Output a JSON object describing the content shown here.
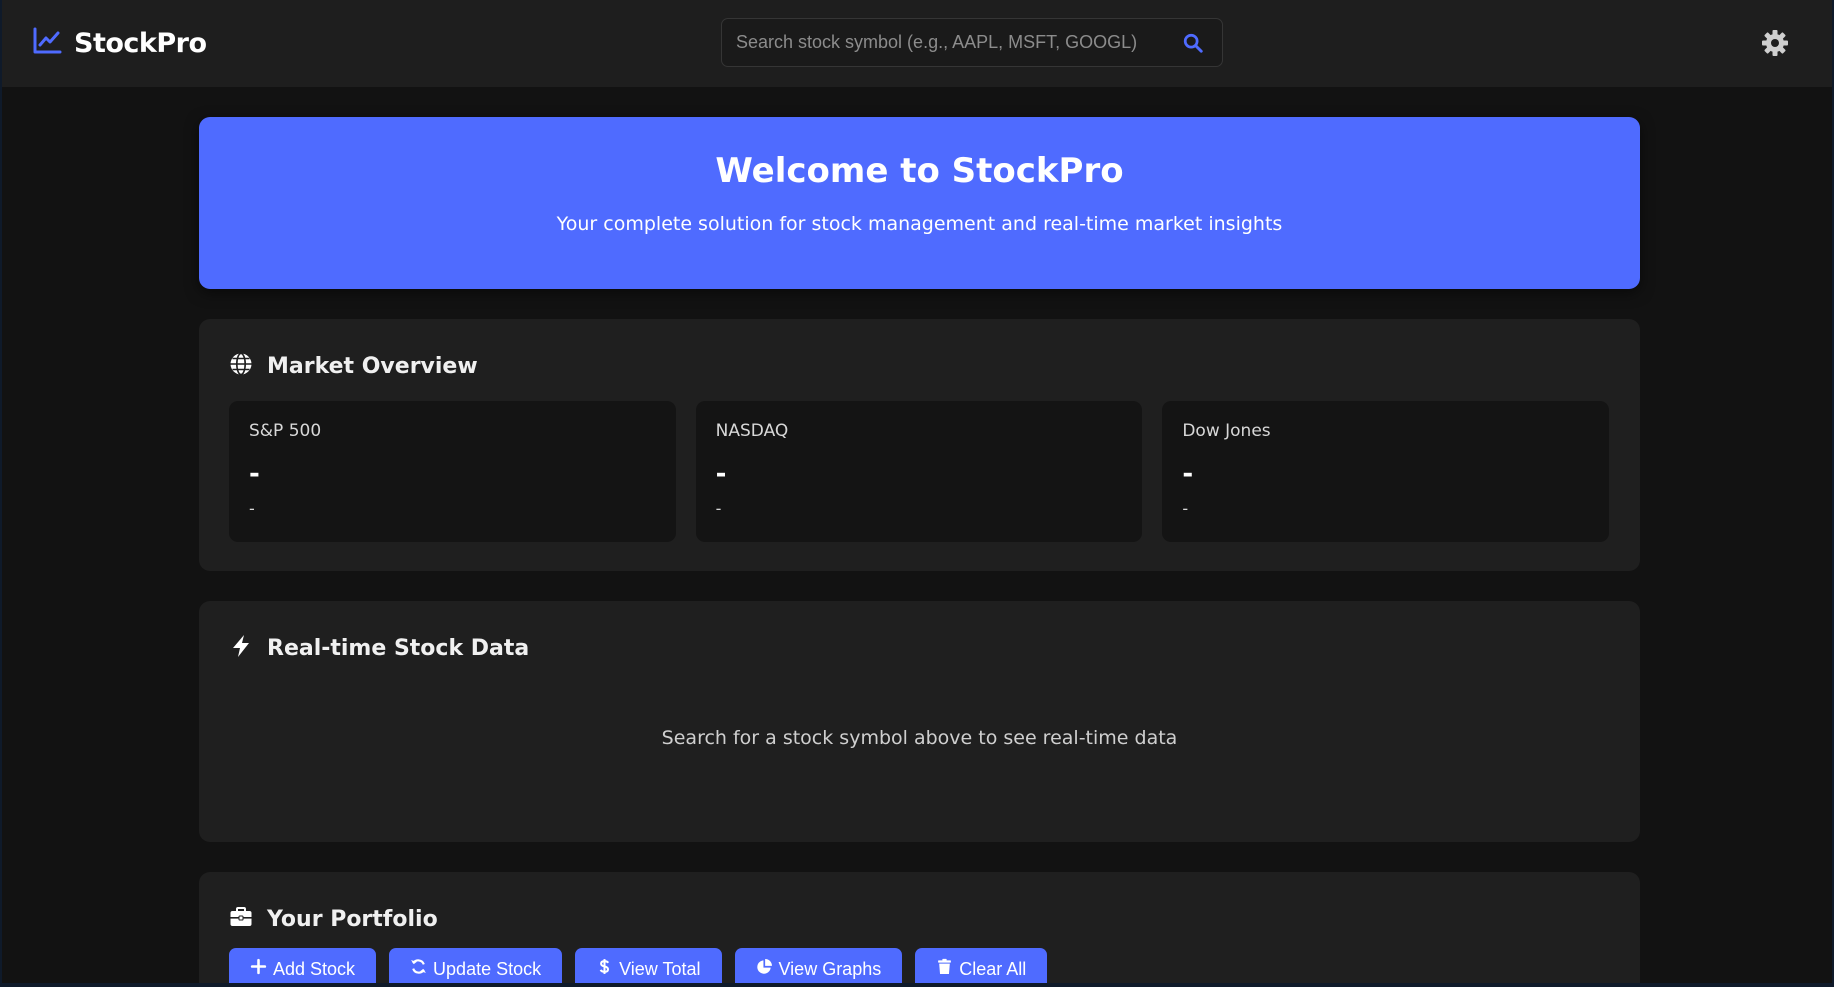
{
  "app": {
    "name": "StockPro",
    "accent_color": "#4f6bff"
  },
  "header": {
    "logo_icon": "chart-line-icon",
    "search": {
      "placeholder": "Search stock symbol (e.g., AAPL, MSFT, GOOGL)",
      "value": "",
      "icon": "search-icon"
    },
    "settings_icon": "gear-icon"
  },
  "hero": {
    "title": "Welcome to StockPro",
    "subtitle": "Your complete solution for stock management and real-time market insights"
  },
  "market_overview": {
    "title": "Market Overview",
    "icon": "globe-icon",
    "indices": [
      {
        "name": "S&P 500",
        "value": "-",
        "change": "-"
      },
      {
        "name": "NASDAQ",
        "value": "-",
        "change": "-"
      },
      {
        "name": "Dow Jones",
        "value": "-",
        "change": "-"
      }
    ]
  },
  "realtime": {
    "title": "Real-time Stock Data",
    "icon": "bolt-icon",
    "empty_message": "Search for a stock symbol above to see real-time data"
  },
  "portfolio": {
    "title": "Your Portfolio",
    "icon": "briefcase-icon",
    "actions": [
      {
        "label": "Add Stock",
        "icon": "plus-icon"
      },
      {
        "label": "Update Stock",
        "icon": "sync-icon"
      },
      {
        "label": "View Total",
        "icon": "dollar-icon"
      },
      {
        "label": "View Graphs",
        "icon": "pie-chart-icon"
      },
      {
        "label": "Clear All",
        "icon": "trash-icon"
      }
    ]
  }
}
